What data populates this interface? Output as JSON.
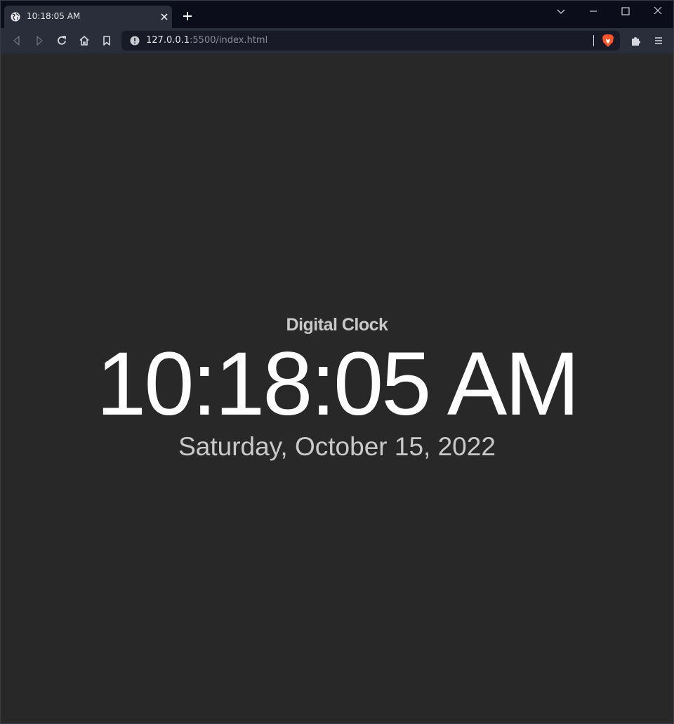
{
  "browser": {
    "tab": {
      "title": "10:18:05 AM",
      "favicon": "globe-icon"
    },
    "new_tab_icon": "plus-icon",
    "window_controls": [
      "chevron-down-icon",
      "minimize-icon",
      "maximize-icon",
      "close-icon"
    ],
    "toolbar": {
      "buttons": [
        "back-icon",
        "forward-icon",
        "reload-icon",
        "home-icon",
        "bookmark-icon"
      ],
      "url_host": "127.0.0.1",
      "url_rest": ":5500/index.html",
      "site_info_icon": "info-icon",
      "shields_icon": "brave-lion-icon",
      "extensions_icon": "puzzle-icon",
      "menu_icon": "hamburger-icon"
    }
  },
  "page": {
    "heading": "Digital Clock",
    "time": "10:18:05 AM",
    "date": "Saturday, October 15, 2022",
    "colors": {
      "background": "#282828",
      "time": "#ffffff",
      "secondary_text": "#c9c9c9"
    }
  }
}
